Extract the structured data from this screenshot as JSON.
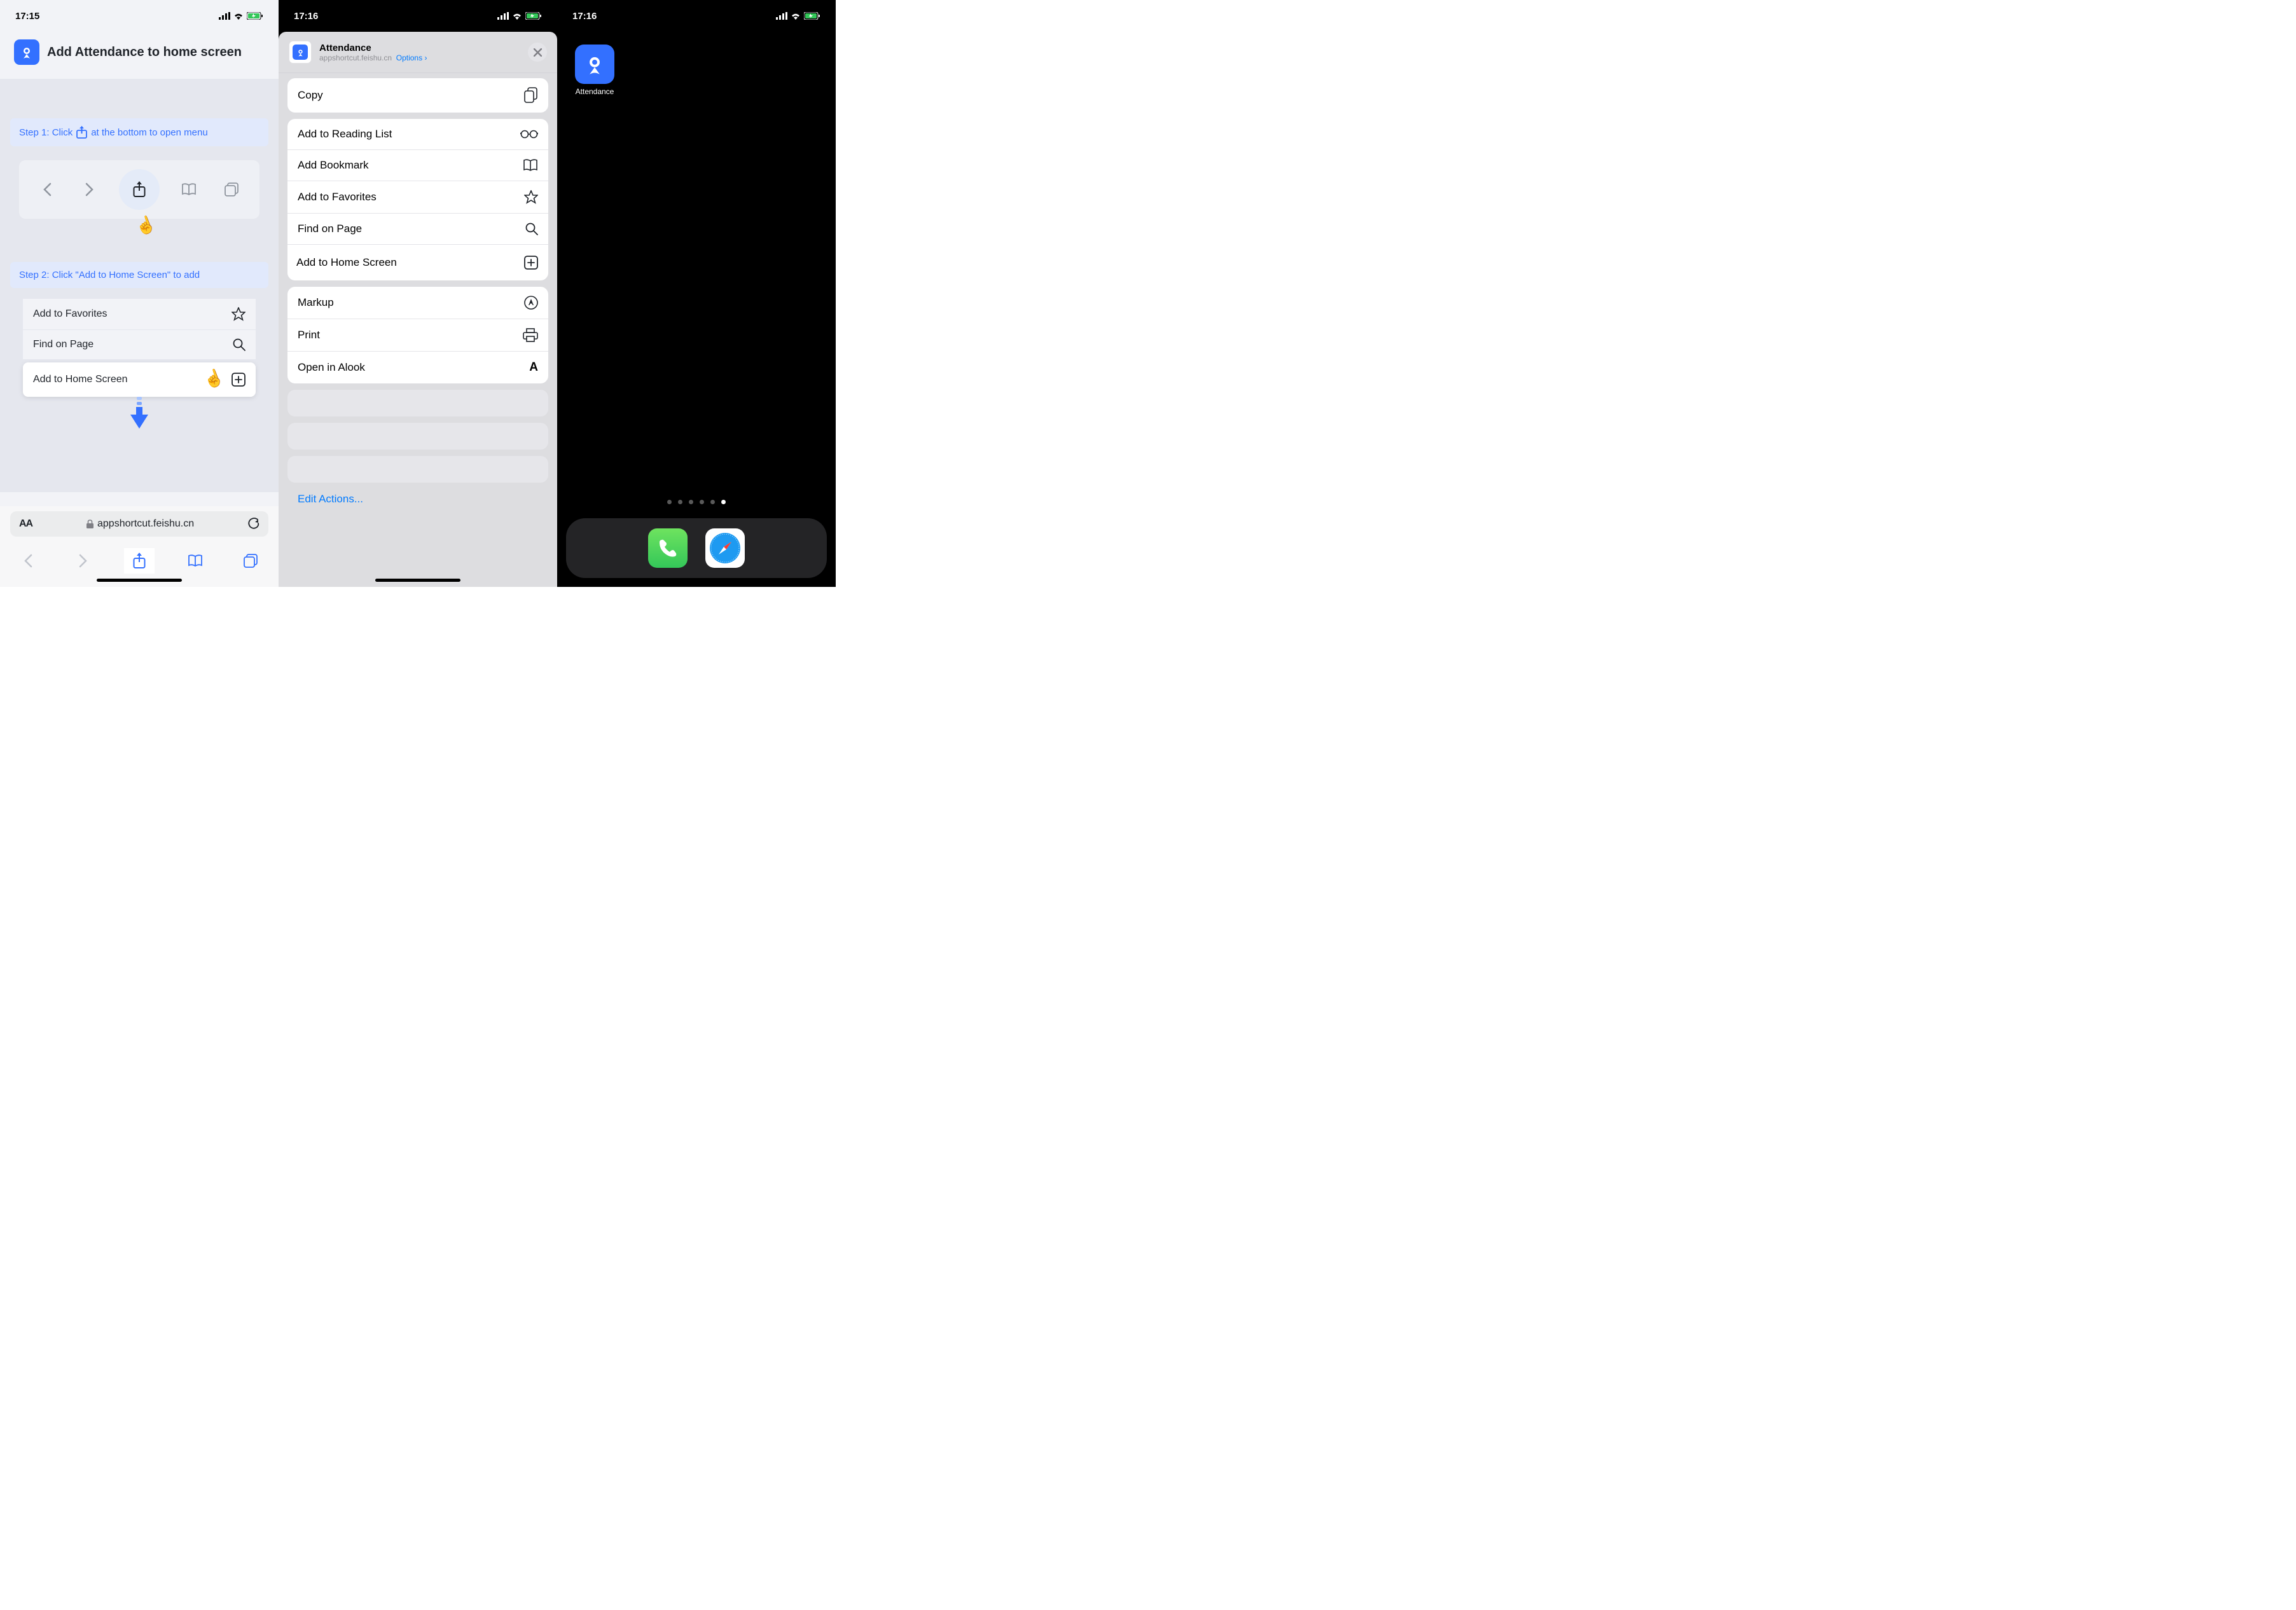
{
  "screen1": {
    "time": "17:15",
    "title": "Add Attendance to home screen",
    "step1_pre": "Step 1: Click",
    "step1_post": "at the bottom to open menu",
    "step2": "Step 2: Click \"Add to Home Screen\" to add",
    "menu_items": {
      "favorites": "Add to Favorites",
      "find": "Find on Page",
      "add_home": "Add to Home Screen"
    },
    "url_aa": "AA",
    "url": "appshortcut.feishu.cn"
  },
  "screen2": {
    "time": "17:16",
    "sheet_title": "Attendance",
    "sheet_url": "appshortcut.feishu.cn",
    "options_label": "Options",
    "items": {
      "copy": "Copy",
      "reading_list": "Add to Reading List",
      "bookmark": "Add Bookmark",
      "favorites": "Add to Favorites",
      "find": "Find on Page",
      "add_home": "Add to Home Screen",
      "markup": "Markup",
      "print": "Print",
      "alook": "Open in Alook"
    },
    "edit_actions": "Edit Actions..."
  },
  "screen3": {
    "time": "17:16",
    "app_label": "Attendance"
  }
}
